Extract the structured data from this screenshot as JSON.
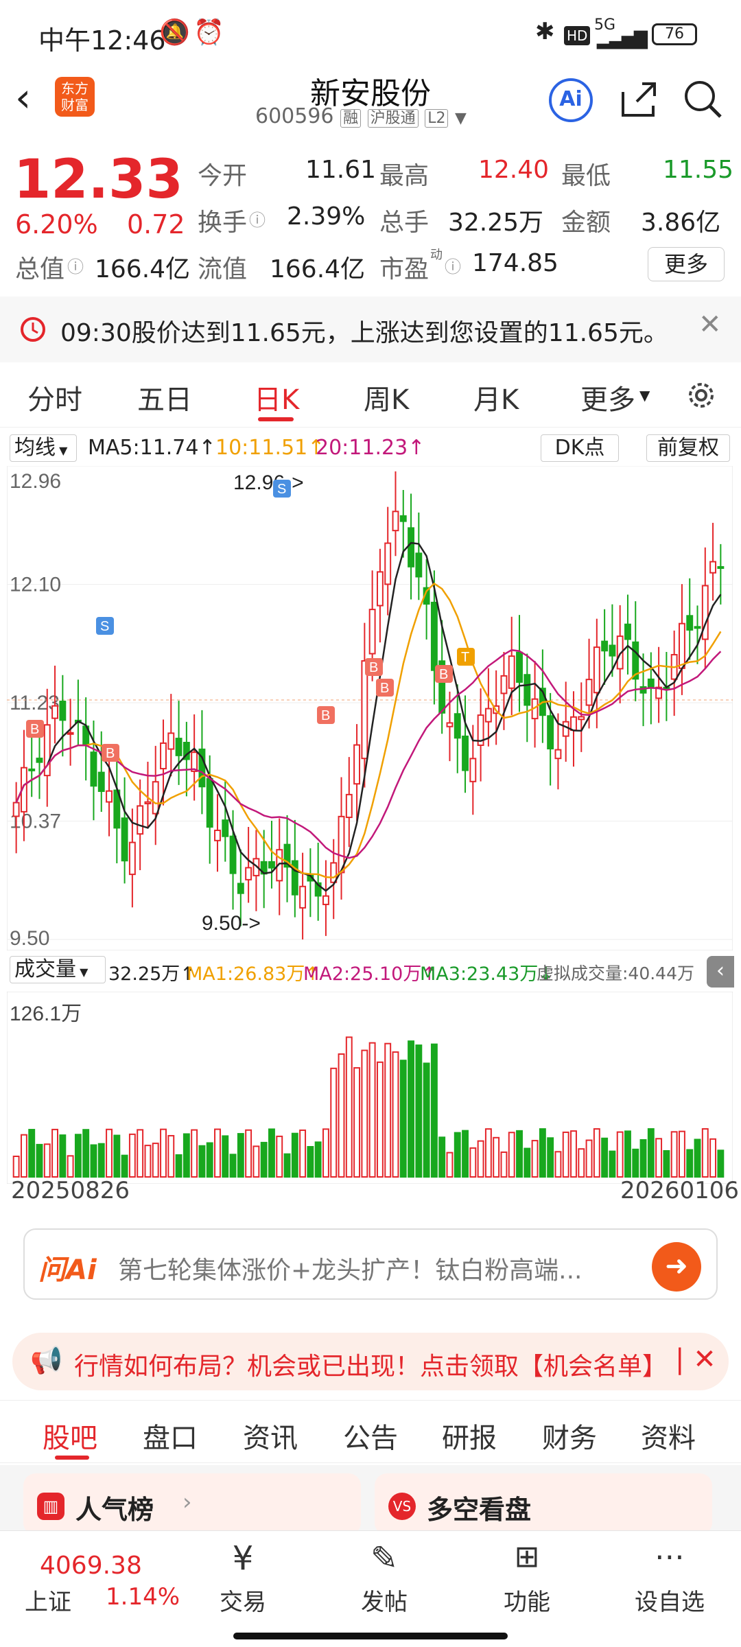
{
  "status_bar": {
    "time": "中午12:46",
    "network": "5G",
    "battery": "76"
  },
  "header": {
    "logo_line1": "东方",
    "logo_line2": "财富",
    "title": "新安股份",
    "code": "600596",
    "tags": [
      "融",
      "沪股通",
      "L2"
    ],
    "ai_label": "Ai"
  },
  "quote": {
    "price": "12.33",
    "change_pct": "6.20%",
    "change": "0.72",
    "fields": [
      {
        "label": "今开",
        "value": "11.61"
      },
      {
        "label": "最高",
        "value": "12.40"
      },
      {
        "label": "最低",
        "value": "11.55"
      },
      {
        "label": "换手",
        "value": "2.39%"
      },
      {
        "label": "总手",
        "value": "32.25万"
      },
      {
        "label": "金额",
        "value": "3.86亿"
      },
      {
        "label": "总值",
        "value": "166.4亿"
      },
      {
        "label": "流值",
        "value": "166.4亿"
      },
      {
        "label": "市盈",
        "value": "174.85",
        "sup": "动"
      }
    ],
    "more": "更多"
  },
  "alert": {
    "text": "09:30股价达到11.65元，上涨达到您设置的11.65元。"
  },
  "tabs": [
    "分时",
    "五日",
    "日K",
    "周K",
    "月K",
    "更多"
  ],
  "active_tab": "日K",
  "ma_bar": {
    "selector": "均线",
    "ma5": "MA5:11.74↑",
    "ma10": "10:11.51↑",
    "ma20": "20:11.23↑",
    "dk": "DK点",
    "fq": "前复权"
  },
  "vol_bar": {
    "selector": "成交量",
    "vol": "32.25万↑",
    "ma1": "MA1:26.83万↑",
    "ma2": "MA2:25.10万↑",
    "ma3": "MA3:23.43万↓",
    "virtual": "虚拟成交量:40.44万"
  },
  "chart_data": {
    "type": "candlestick",
    "y_ticks": [
      "12.96",
      "12.10",
      "11.23",
      "10.37",
      "9.50"
    ],
    "ylim": [
      9.5,
      12.96
    ],
    "high_label": "12.96->",
    "low_label": "9.50->",
    "vol_max_label": "126.1万",
    "date_start": "20250826",
    "date_end": "20260106",
    "markers": [
      "S",
      "S",
      "B",
      "B",
      "B",
      "B",
      "B",
      "B",
      "T"
    ],
    "colors": {
      "up": "#e4262b",
      "down": "#18a81e",
      "ma5": "#222222",
      "ma10": "#f0a000",
      "ma20": "#c2187a"
    }
  },
  "ai_bar": {
    "brand": "问Ai",
    "text": "第七轮集体涨价+龙头扩产！钛白粉高端..."
  },
  "banner": {
    "text": "行情如何布局？机会或已出现！点击领取【机会名单】"
  },
  "subtabs": [
    "股吧",
    "盘口",
    "资讯",
    "公告",
    "研报",
    "财务",
    "资料"
  ],
  "cards": [
    {
      "label": "人气榜"
    },
    {
      "label": "多空看盘"
    }
  ],
  "bottom": {
    "index_value": "4069.38",
    "index_name": "上证",
    "index_pct": "1.14%",
    "items": [
      "交易",
      "发帖",
      "功能",
      "设自选"
    ]
  }
}
